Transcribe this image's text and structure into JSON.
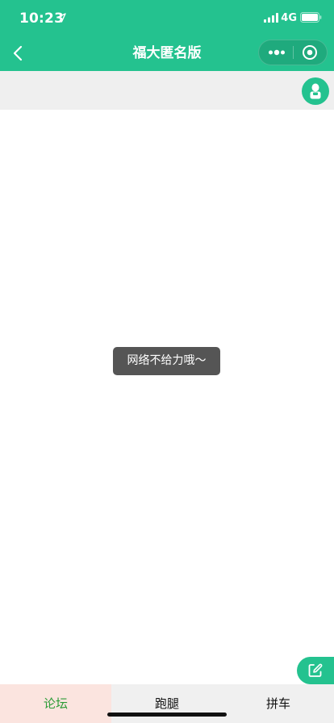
{
  "status_bar": {
    "time": "10:23",
    "network": "4G"
  },
  "nav_bar": {
    "title": "福大匿名版"
  },
  "toast": {
    "message": "网络不给力哦～"
  },
  "tabs": [
    {
      "label": "论坛",
      "active": true
    },
    {
      "label": "跑腿",
      "active": false
    },
    {
      "label": "拼车",
      "active": false
    }
  ],
  "colors": {
    "primary": "#24c28f",
    "active_tab_bg": "#fbe4df",
    "active_tab_text": "#2d9c38",
    "tab_bar_bg": "#f0f0f0",
    "band_bg": "#efefef"
  },
  "icons": {
    "back": "back-chevron-icon",
    "more": "more-dots-icon",
    "close": "capsule-close-icon",
    "avatar": "person-avatar-icon",
    "edit": "edit-icon",
    "location": "location-arrow-icon",
    "signal": "signal-icon",
    "battery": "battery-icon"
  }
}
